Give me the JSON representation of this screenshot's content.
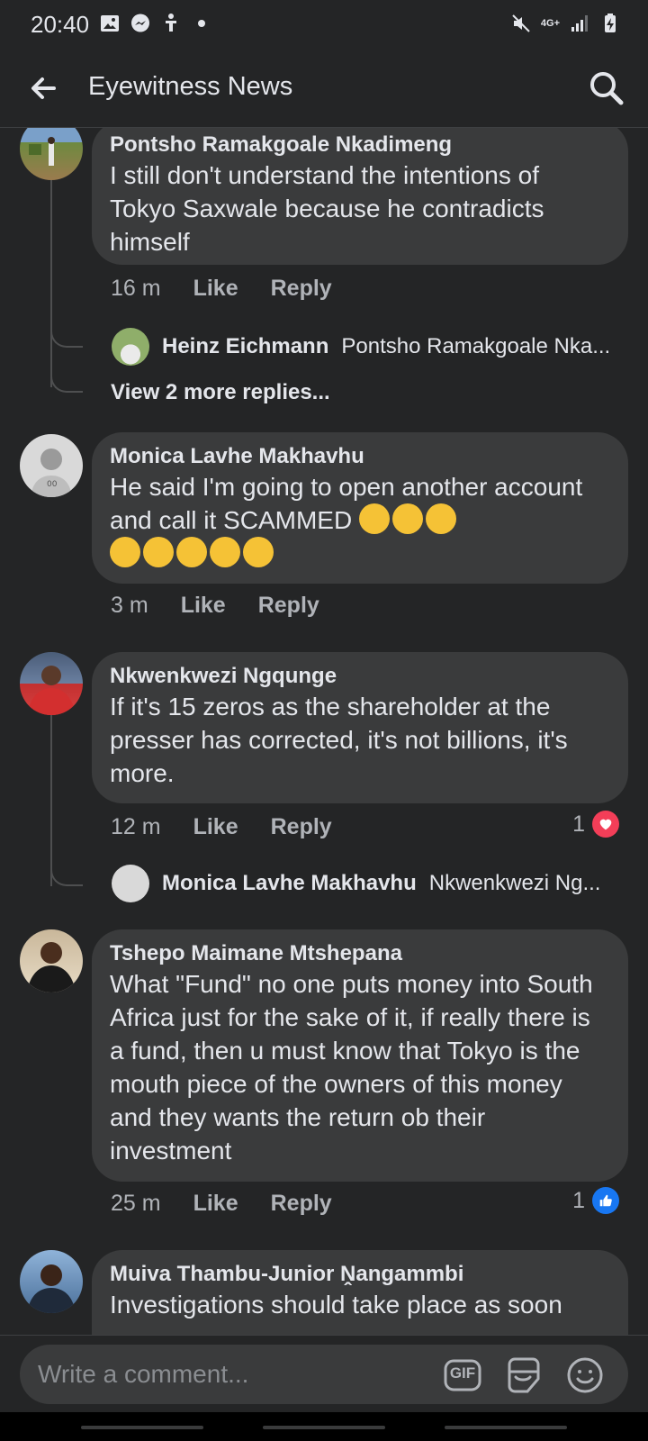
{
  "status_bar": {
    "time": "20:40",
    "left_icons": [
      "gallery-icon",
      "messenger-icon",
      "accessibility-icon",
      "dot-icon"
    ],
    "right_icons": [
      "mute-icon",
      "network-4g-icon",
      "signal-icon",
      "battery-charging-icon"
    ],
    "network_label": "4G+"
  },
  "app_bar": {
    "title": "Eyewitness News",
    "back_icon": "arrow-left-icon",
    "search_icon": "search-icon"
  },
  "comments": [
    {
      "author": "Pontsho Ramakgoale Nkadimeng",
      "text": "I still don't understand the intentions of Tokyo Saxwale because he contradicts himself",
      "time": "16 m",
      "like_label": "Like",
      "reply_label": "Reply",
      "reply_preview": {
        "author": "Heinz Eichmann",
        "text": "Pontsho Ramakgoale Nka..."
      },
      "view_more": "View 2 more replies..."
    },
    {
      "author": "Monica Lavhe Makhavhu",
      "text": "He said I'm going to open another account and call it SCAMMED",
      "emoji": "😅😅😅😅😅😅😅😅",
      "time": "3 m",
      "like_label": "Like",
      "reply_label": "Reply"
    },
    {
      "author": "Nkwenkwezi Ngqunge",
      "text": "If it's 15 zeros as the shareholder at the presser has corrected, it's not billions, it's more.",
      "time": "12 m",
      "like_label": "Like",
      "reply_label": "Reply",
      "reaction_count": "1",
      "reaction_type": "heart-icon",
      "reply_preview": {
        "author": "Monica Lavhe Makhavhu",
        "text": "Nkwenkwezi Ng..."
      }
    },
    {
      "author": "Tshepo Maimane Mtshepana",
      "text": "What \"Fund\" no one puts money into South Africa just for the sake of it, if really there is a fund, then u must know that Tokyo is the mouth piece of the owners of this money and they wants the return ob their investment",
      "time": "25 m",
      "like_label": "Like",
      "reply_label": "Reply",
      "reaction_count": "1",
      "reaction_type": "thumbs-up-icon"
    },
    {
      "author": "Muiva Thambu-Junior Ṋangammbi",
      "text": "Investigations should take place as soon"
    }
  ],
  "composer": {
    "placeholder": "Write a comment...",
    "gif_label": "GIF",
    "sticker_icon": "sticker-icon",
    "emoji_icon": "smiley-icon"
  },
  "colors": {
    "background": "#242526",
    "bubble": "#3a3b3c",
    "text": "#e4e6eb",
    "meta": "#b0b3b8",
    "heart": "#f33e58",
    "like_blue": "#1877f2"
  }
}
